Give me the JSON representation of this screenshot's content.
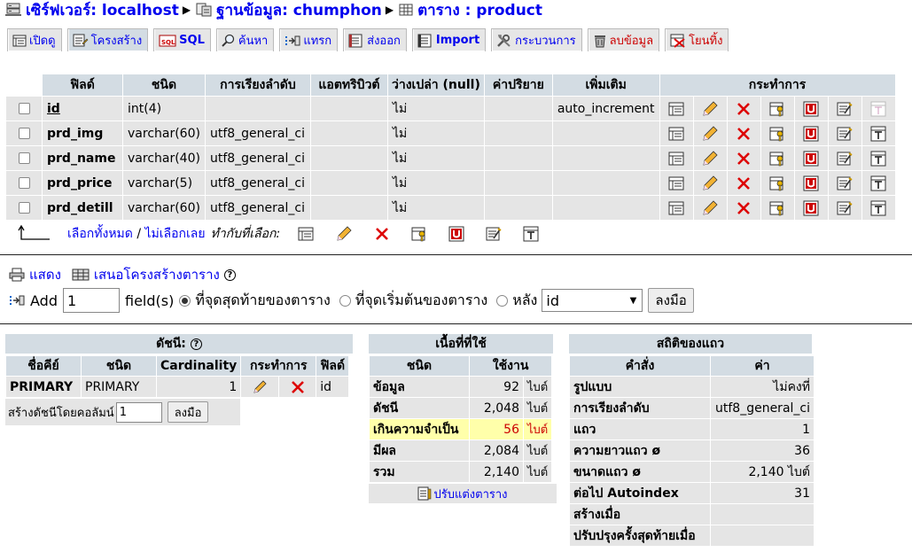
{
  "breadcrumb": {
    "server_label": "เซิร์ฟเวอร์: localhost",
    "database_label": "ฐานข้อมูล: chumphon",
    "table_label": "ตาราง : product"
  },
  "tabs": [
    {
      "label": "เปิดดู",
      "icon": "browse-icon"
    },
    {
      "label": "โครงสร้าง",
      "icon": "structure-icon"
    },
    {
      "label": "SQL",
      "icon": "sql-icon"
    },
    {
      "label": "ค้นหา",
      "icon": "search-icon"
    },
    {
      "label": "แทรก",
      "icon": "insert-icon"
    },
    {
      "label": "ส่งออก",
      "icon": "export-icon"
    },
    {
      "label": "Import",
      "icon": "import-icon"
    },
    {
      "label": "กระบวนการ",
      "icon": "operations-icon"
    },
    {
      "label": "ลบข้อมูล",
      "icon": "empty-icon"
    },
    {
      "label": "โยนทิ้ง",
      "icon": "drop-icon"
    }
  ],
  "structure": {
    "headers": [
      "ฟิลด์",
      "ชนิด",
      "การเรียงลำดับ",
      "แอตทริบิวต์",
      "ว่างเปล่า (null)",
      "ค่าปริยาย",
      "เพิ่มเติม",
      "กระทำการ"
    ],
    "rows": [
      {
        "field": "id",
        "type": "int(4)",
        "collation": "",
        "attributes": "",
        "null": "ไม่",
        "default": "",
        "extra": "auto_increment"
      },
      {
        "field": "prd_img",
        "type": "varchar(60)",
        "collation": "utf8_general_ci",
        "attributes": "",
        "null": "ไม่",
        "default": "",
        "extra": ""
      },
      {
        "field": "prd_name",
        "type": "varchar(40)",
        "collation": "utf8_general_ci",
        "attributes": "",
        "null": "ไม่",
        "default": "",
        "extra": ""
      },
      {
        "field": "prd_price",
        "type": "varchar(5)",
        "collation": "utf8_general_ci",
        "attributes": "",
        "null": "ไม่",
        "default": "",
        "extra": ""
      },
      {
        "field": "prd_detill",
        "type": "varchar(60)",
        "collation": "utf8_general_ci",
        "attributes": "",
        "null": "ไม่",
        "default": "",
        "extra": ""
      }
    ]
  },
  "selection": {
    "check_all": "เลือกทั้งหมด",
    "divider": " / ",
    "uncheck_all": "ไม่เลือกเลย",
    "with_selected": "ทำกับที่เลือก:"
  },
  "actions": {
    "print_view": "แสดง",
    "propose_structure": "เสนอโครงสร้างตาราง",
    "help_glyph": "?"
  },
  "add_fields": {
    "add_label": "Add",
    "count_value": "1",
    "fields_label": "field(s)",
    "at_end": "ที่จุดสุดท้ายของตาราง",
    "at_beginning": "ที่จุดเริ่มต้นของตาราง",
    "after": "หลัง",
    "after_selected": "id",
    "go_button": "ลงมือ"
  },
  "indexes": {
    "title": "ดัชนี:",
    "headers": [
      "ชื่อคีย์",
      "ชนิด",
      "Cardinality",
      "กระทำการ",
      "ฟิลด์"
    ],
    "rows": [
      {
        "keyname": "PRIMARY",
        "type": "PRIMARY",
        "cardinality": "1",
        "field": "id"
      }
    ],
    "create_label": "สร้างดัชนีโดยคอลัมน์",
    "create_value": "1",
    "go_button": "ลงมือ"
  },
  "space": {
    "title": "เนื้อที่ที่ใช้",
    "headers": [
      "ชนิด",
      "ใช้งาน"
    ],
    "rows": [
      {
        "label": "ข้อมูล",
        "value": "92",
        "unit": "ไบต์"
      },
      {
        "label": "ดัชนี",
        "value": "2,048",
        "unit": "ไบต์"
      },
      {
        "label": "เกินความจำเป็น",
        "value": "56",
        "unit": "ไบต์"
      },
      {
        "label": "มีผล",
        "value": "2,084",
        "unit": "ไบต์"
      },
      {
        "label": "รวม",
        "value": "2,140",
        "unit": "ไบต์"
      }
    ],
    "optimize_link": "ปรับแต่งตาราง"
  },
  "row_stats": {
    "title": "สถิติของแถว",
    "headers": [
      "คำสั่ง",
      "ค่า"
    ],
    "rows": [
      {
        "label": "รูปแบบ",
        "value": "ไม่คงที่"
      },
      {
        "label": "การเรียงลำดับ",
        "value": "utf8_general_ci"
      },
      {
        "label": "แถว",
        "value": "1"
      },
      {
        "label": "ความยาวแถว ø",
        "value": "36"
      },
      {
        "label": "ขนาดแถว ø",
        "value": "2,140 ไบต์"
      },
      {
        "label": "ต่อไป Autoindex",
        "value": "31"
      },
      {
        "label": "สร้างเมื่อ",
        "value": ""
      },
      {
        "label": "ปรับปรุงครั้งสุดท้ายเมื่อ",
        "value": ""
      }
    ]
  },
  "colors": {
    "link": "#0000ee",
    "header_bg": "#d3dce3",
    "row_bg": "#e5e5e5",
    "warning_bg": "#ffffaa",
    "warning_text": "#cc0000"
  }
}
